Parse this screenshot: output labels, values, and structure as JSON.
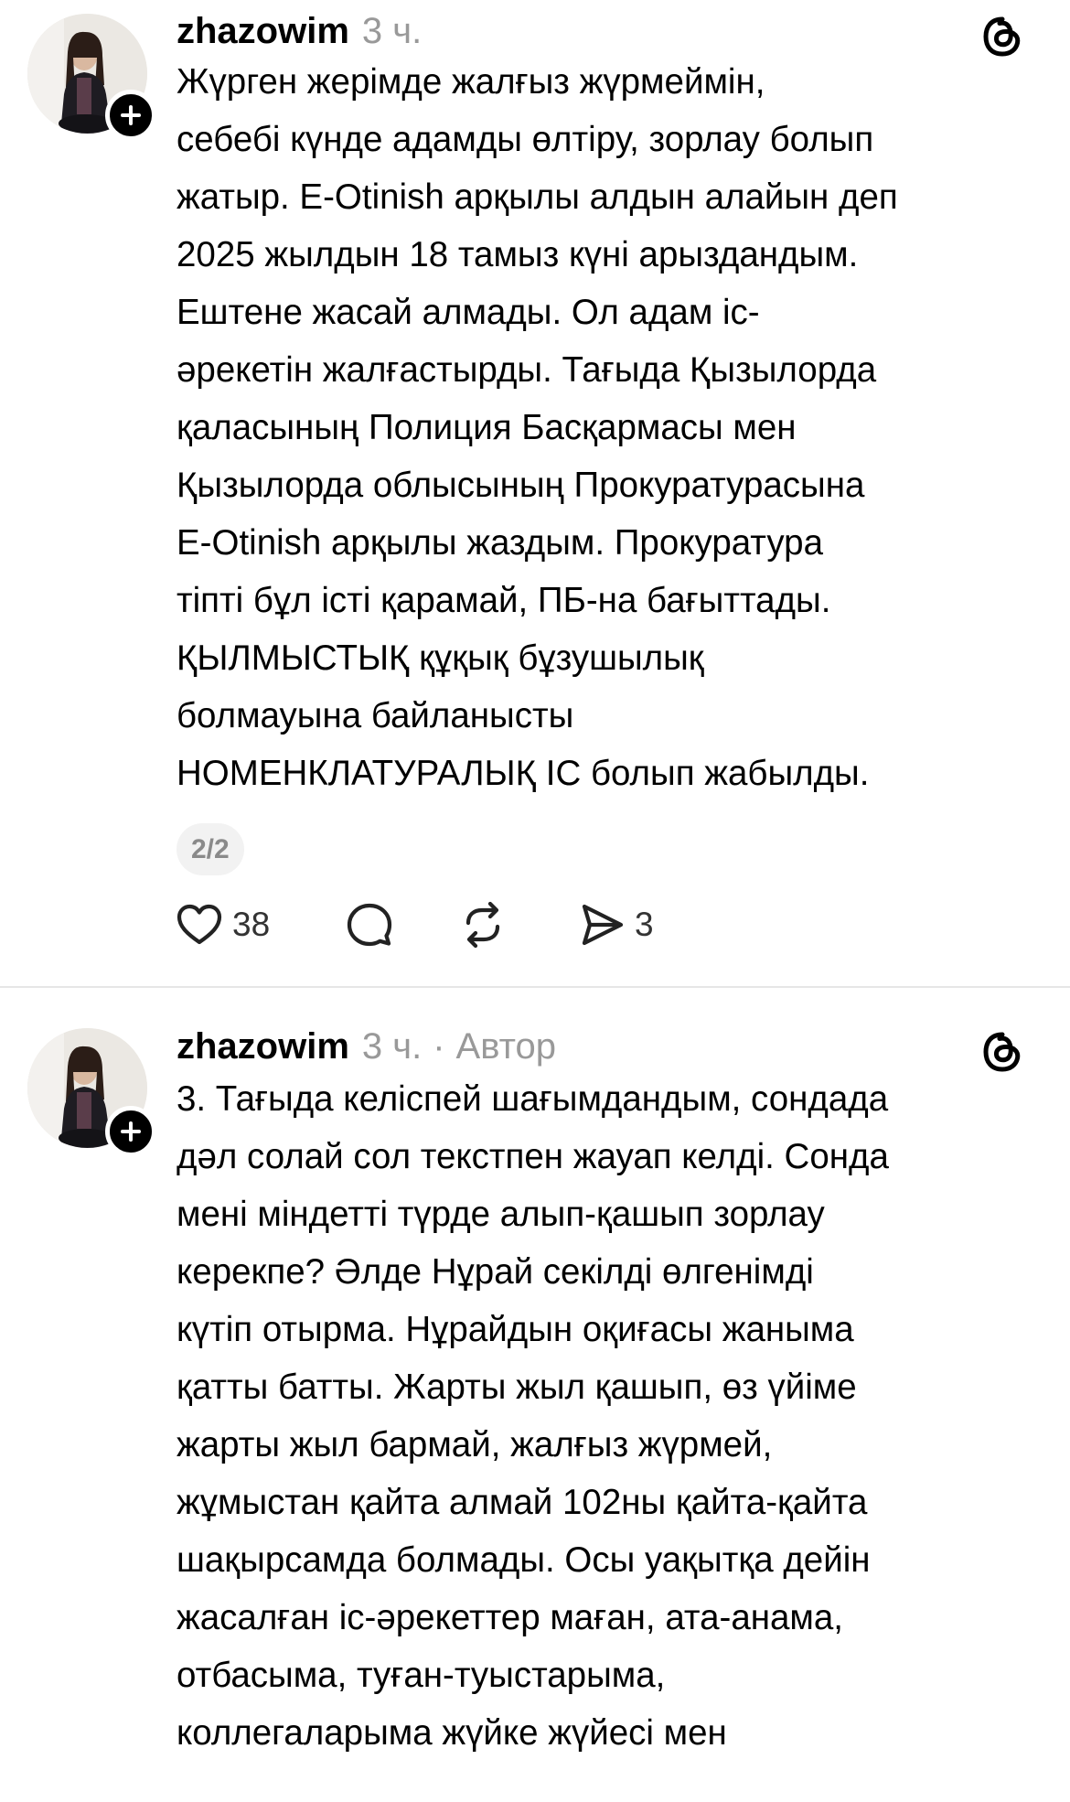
{
  "posts": [
    {
      "username": "zhazowim",
      "time": "3 ч.",
      "author_tag": "",
      "text": "Жүрген жерімде жалғыз жүрмеймін,\nсебебі күнде адамды өлтіру, зорлау болып\nжатыр. E-Otinish арқылы алдын алайын деп\n2025 жылдын 18 тамыз күні арыздандым.\nЕштене жасай алмады. Ол адам іс-\nәрекетін жалғастырды. Тағыда Қызылорда\nқаласының Полиция Басқармасы мен\nҚызылорда облысының Прокуратурасына\nE-Otinish арқылы жаздым. Прокуратура\nтіпті бұл істі қарамай, ПБ-на бағыттады.\nҚЫЛМЫСТЫҚ құқық бұзушылық\nболмауына байланысты\nНОМЕНКЛАТУРАЛЫҚ ІС болып жабылды.",
      "page_badge": "2/2",
      "likes": "38",
      "comments": "",
      "reposts": "",
      "shares": "3"
    },
    {
      "username": "zhazowim",
      "time": "3 ч.",
      "dot": "·",
      "author_tag": "Автор",
      "text": "3. Тағыда келіспей шағымдандым, сондада\nдәл солай сол текстпен жауап келді. Сонда\nмені міндетті түрде алып-қашып зорлау\nкерекпе? Әлде Нұрай секілді өлгенімді\nкүтіп отырма. Нұрайдын оқиғасы жаныма\nқатты батты. Жарты жыл қашып, өз үйіме\nжарты жыл бармай, жалғыз жүрмей,\nжұмыстан қайта алмай 102ны қайта-қайта\nшақырсамда болмады. Осы уақытқа дейін\nжасалған іс-әрекеттер маған, ата-анама,\nотбасыма, туған-туыстарыма,\nколлегаларыма жүйке жүйесі мен"
    }
  ],
  "icons": {
    "threads": "threads-logo-icon",
    "follow": "plus-icon",
    "like": "heart-icon",
    "comment": "comment-bubble-icon",
    "repost": "repost-icon",
    "share": "send-icon"
  },
  "colors": {
    "text": "#000000",
    "muted": "#999999",
    "badge_bg": "#f2f2f2",
    "divider": "#e6e6e6"
  }
}
